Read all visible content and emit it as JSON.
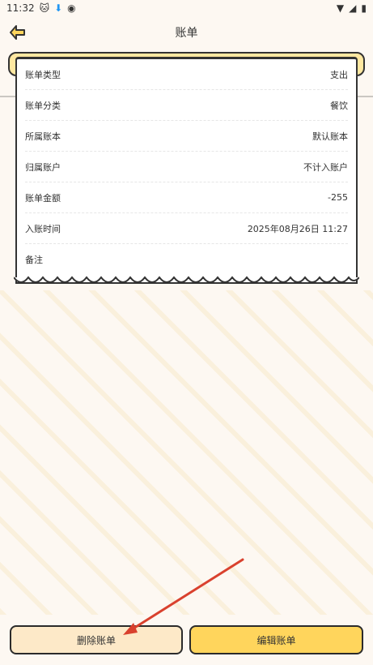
{
  "status_bar": {
    "time": "11:32",
    "icons_left": [
      "cat-icon",
      "download-icon",
      "vpn-icon"
    ],
    "icons_right": [
      "wifi-icon",
      "signal-icon",
      "battery-icon"
    ]
  },
  "appbar": {
    "title": "账单",
    "back_icon": "back-arrow-icon"
  },
  "bill": {
    "rows": [
      {
        "label": "账单类型",
        "value": "支出"
      },
      {
        "label": "账单分类",
        "value": "餐饮"
      },
      {
        "label": "所属账本",
        "value": "默认账本"
      },
      {
        "label": "归属账户",
        "value": "不计入账户"
      },
      {
        "label": "账单金额",
        "value": "-255"
      },
      {
        "label": "入账时间",
        "value": "2025年08月26日 11:27"
      },
      {
        "label": "备注",
        "value": ""
      }
    ]
  },
  "buttons": {
    "delete_label": "删除账单",
    "edit_label": "编辑账单"
  },
  "colors": {
    "background": "#fdf8f2",
    "accent_yellow": "#ffd55c",
    "light_orange": "#fde9c8",
    "annotation_arrow": "#d9412e"
  }
}
